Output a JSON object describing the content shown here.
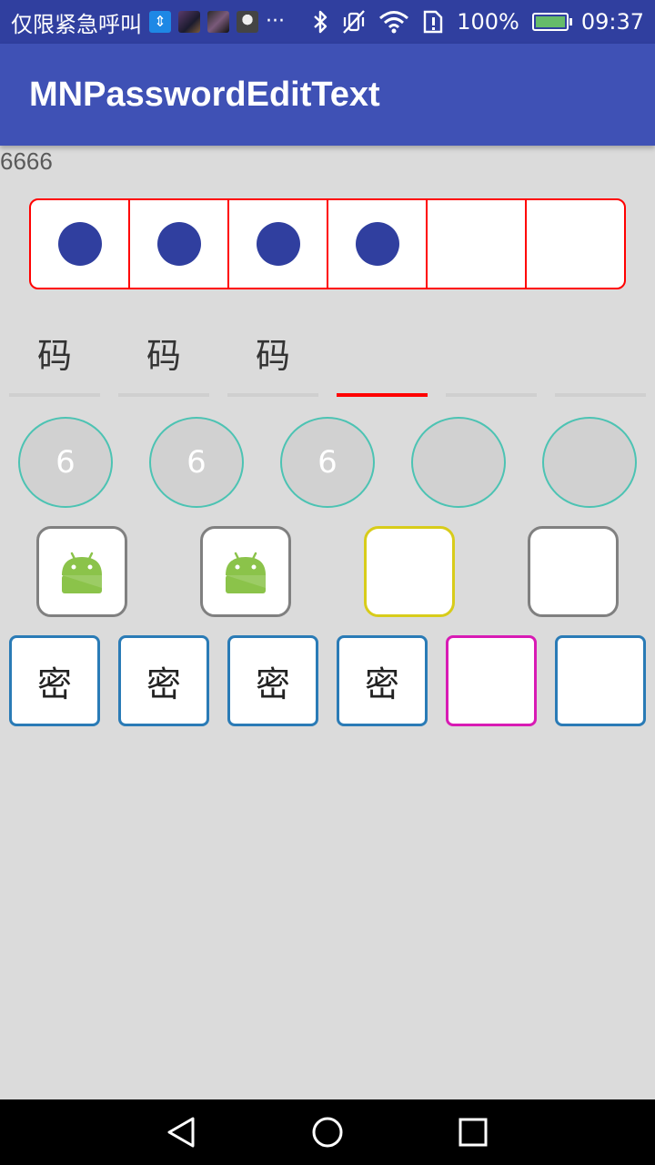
{
  "status_bar": {
    "carrier": "仅限紧急呼叫",
    "more": "···",
    "battery_percent": "100%",
    "time": "09:37",
    "icons": [
      "usb-icon",
      "notification-thumbnail",
      "notification-thumbnail",
      "notification-thumbnail",
      "bluetooth-icon",
      "vibrate-off-icon",
      "wifi-icon",
      "sim-alert-icon",
      "battery-icon"
    ],
    "battery_level": 1.0
  },
  "app_bar": {
    "title": "MNPasswordEditText"
  },
  "value_text": "6666",
  "row1_dots": {
    "total": 6,
    "filled": 4,
    "dot_color": "#303f9f",
    "border_color": "#ff0000"
  },
  "row2_underline": {
    "chars": [
      "码",
      "码",
      "码",
      "",
      "",
      ""
    ],
    "active_index": 3,
    "active_color": "#ff0000"
  },
  "row3_circles": {
    "chars": [
      "6",
      "6",
      "6",
      "",
      ""
    ],
    "border_color": "#4cc3b3"
  },
  "row4_rounded": {
    "icons": [
      "android-icon",
      "android-icon",
      "",
      ""
    ],
    "active_index": 2,
    "active_color": "#d8cc1a"
  },
  "row5_square": {
    "chars": [
      "密",
      "密",
      "密",
      "密",
      "",
      ""
    ],
    "active_index": 4,
    "active_color": "#d81bb4",
    "border_color": "#2a7bb6"
  },
  "nav_bar": {
    "buttons": [
      "back-icon",
      "home-icon",
      "recents-icon"
    ]
  }
}
